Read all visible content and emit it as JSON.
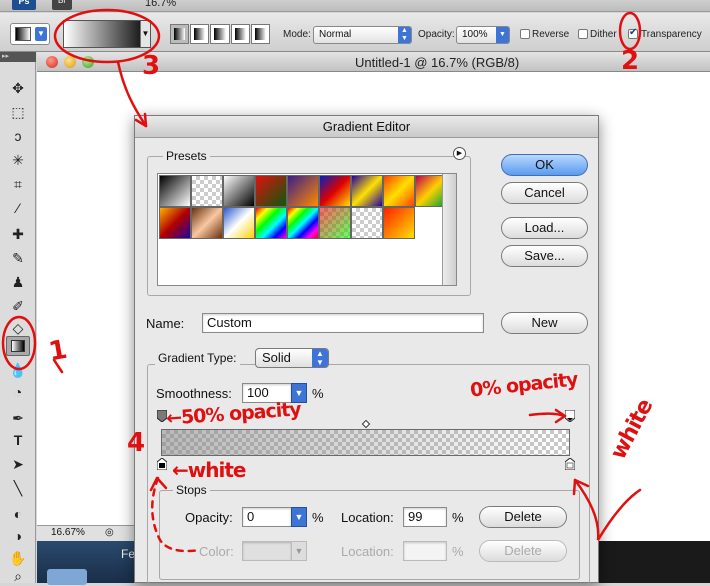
{
  "app": {
    "zoom_menu_value": "16.7%",
    "ps_badge": "Ps",
    "br_badge": "Br"
  },
  "options_bar": {
    "mode_label": "Mode:",
    "mode_value": "Normal",
    "opacity_label": "Opacity:",
    "opacity_value": "100%",
    "reverse_label": "Reverse",
    "reverse_checked": false,
    "dither_label": "Dither",
    "dither_checked": false,
    "transparency_label": "Transparency",
    "transparency_checked": true
  },
  "document": {
    "title": "Untitled-1 @ 16.7% (RGB/8)",
    "zoom_status": "16.67%",
    "desktop_text": "Fe"
  },
  "dialog": {
    "title": "Gradient Editor",
    "presets_label": "Presets",
    "ok_label": "OK",
    "cancel_label": "Cancel",
    "load_label": "Load...",
    "save_label": "Save...",
    "name_label": "Name:",
    "name_value": "Custom",
    "new_label": "New",
    "gradient_type_label": "Gradient Type:",
    "gradient_type_value": "Solid",
    "smoothness_label": "Smoothness:",
    "smoothness_value": "100",
    "smoothness_unit": "%",
    "stops_label": "Stops",
    "opacity_label": "Opacity:",
    "opacity_value": "0",
    "opacity_unit": "%",
    "location_label": "Location:",
    "location_value": "99",
    "location_unit": "%",
    "delete_label": "Delete",
    "color_label": "Color:",
    "color_location_label": "Location:",
    "color_location_unit": "%",
    "color_delete_label": "Delete"
  },
  "annotations": {
    "n1": "1",
    "n2": "2",
    "n3": "3",
    "n4": "4",
    "opacity_50": "←50% opacity",
    "opacity_0": "0% opacity",
    "white_left": "←white",
    "white_right": "white"
  },
  "colors": {
    "annotation_red": "#e01010",
    "accent_blue": "#3c74d8"
  }
}
